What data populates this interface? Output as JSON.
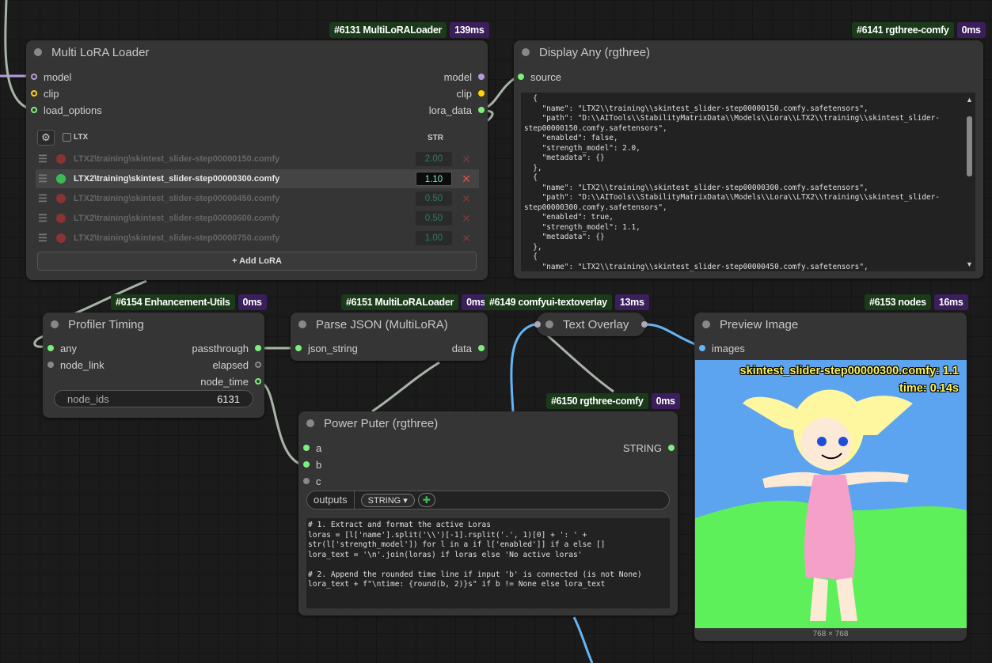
{
  "multi_lora": {
    "badge_id": "#6131 MultiLoRALoader",
    "badge_time": "139ms",
    "title": "Multi LoRA Loader",
    "inputs": [
      "model",
      "clip",
      "load_options"
    ],
    "outputs": [
      "model",
      "clip",
      "lora_data"
    ],
    "settings_icon": "⚙",
    "ltx_label": "LTX",
    "str_header": "STR",
    "loras": [
      {
        "name": "LTX2\\training\\skintest_slider-step00000150.comfy",
        "str": "2.00",
        "enabled": false
      },
      {
        "name": "LTX2\\training\\skintest_slider-step00000300.comfy",
        "str": "1.10",
        "enabled": true
      },
      {
        "name": "LTX2\\training\\skintest_slider-step00000450.comfy",
        "str": "0.50",
        "enabled": false
      },
      {
        "name": "LTX2\\training\\skintest_slider-step00000600.comfy",
        "str": "0.50",
        "enabled": false
      },
      {
        "name": "LTX2\\training\\skintest_slider-step00000750.comfy",
        "str": "1.00",
        "enabled": false
      }
    ],
    "add_label": "+ Add LoRA"
  },
  "display_any": {
    "badge_id": "#6141 rgthree-comfy",
    "badge_time": "0ms",
    "title": "Display Any (rgthree)",
    "input": "source",
    "text": "  {\n    \"name\": \"LTX2\\\\training\\\\skintest_slider-step00000150.comfy.safetensors\",\n    \"path\": \"D:\\\\AITools\\\\StabilityMatrixData\\\\Models\\\\Lora\\\\LTX2\\\\training\\\\skintest_slider-\nstep00000150.comfy.safetensors\",\n    \"enabled\": false,\n    \"strength_model\": 2.0,\n    \"metadata\": {}\n  },\n  {\n    \"name\": \"LTX2\\\\training\\\\skintest_slider-step00000300.comfy.safetensors\",\n    \"path\": \"D:\\\\AITools\\\\StabilityMatrixData\\\\Models\\\\Lora\\\\LTX2\\\\training\\\\skintest_slider-\nstep00000300.comfy.safetensors\",\n    \"enabled\": true,\n    \"strength_model\": 1.1,\n    \"metadata\": {}\n  },\n  {\n    \"name\": \"LTX2\\\\training\\\\skintest_slider-step00000450.comfy.safetensors\","
  },
  "profiler": {
    "badge_id": "#6154 Enhancement-Utils",
    "badge_time": "0ms",
    "title": "Profiler Timing",
    "inputs": [
      "any",
      "node_link"
    ],
    "outputs": [
      "passthrough",
      "elapsed",
      "node_time"
    ],
    "widget_label": "node_ids",
    "widget_value": "6131"
  },
  "parse_json": {
    "badge_id": "#6151 MultiLoRALoader",
    "badge_time": "0ms",
    "title": "Parse JSON (MultiLoRA)",
    "input": "json_string",
    "output": "data"
  },
  "text_overlay": {
    "badge_id": "#6149 comfyui-textoverlay",
    "badge_time": "13ms",
    "title": "Text Overlay"
  },
  "preview": {
    "badge_id": "#6153 nodes",
    "badge_time": "16ms",
    "title": "Preview Image",
    "input": "images",
    "overlay_line1": "skintest_slider-step00000300.comfy: 1.1",
    "overlay_line2": "time: 0.14s",
    "size_label": "768 × 768"
  },
  "power_puter": {
    "badge_id": "#6150 rgthree-comfy",
    "badge_time": "0ms",
    "title": "Power Puter (rgthree)",
    "inputs": [
      "a",
      "b",
      "c"
    ],
    "output": "STRING",
    "outputs_label": "outputs",
    "type_select": "STRING ▾",
    "add_icon": "✚",
    "code": "# 1. Extract and format the active Loras\nloras = [l['name'].split('\\\\')[-1].rsplit('.', 1)[0] + ': ' +\nstr(l['strength_model']) for l in a if l['enabled']] if a else []\nlora_text = '\\n'.join(loras) if loras else 'No active loras'\n\n# 2. Append the rounded time line if input 'b' is connected (is not None)\nlora_text + f\"\\ntime: {round(b, 2)}s\" if b != None else lora_text"
  },
  "colors": {
    "badge_green": "#1a3a1a",
    "badge_purple": "#3a1f5c",
    "wire_grey": "#9aa89a",
    "wire_blue": "#64b5f6",
    "wire_model": "#b39ddb"
  }
}
